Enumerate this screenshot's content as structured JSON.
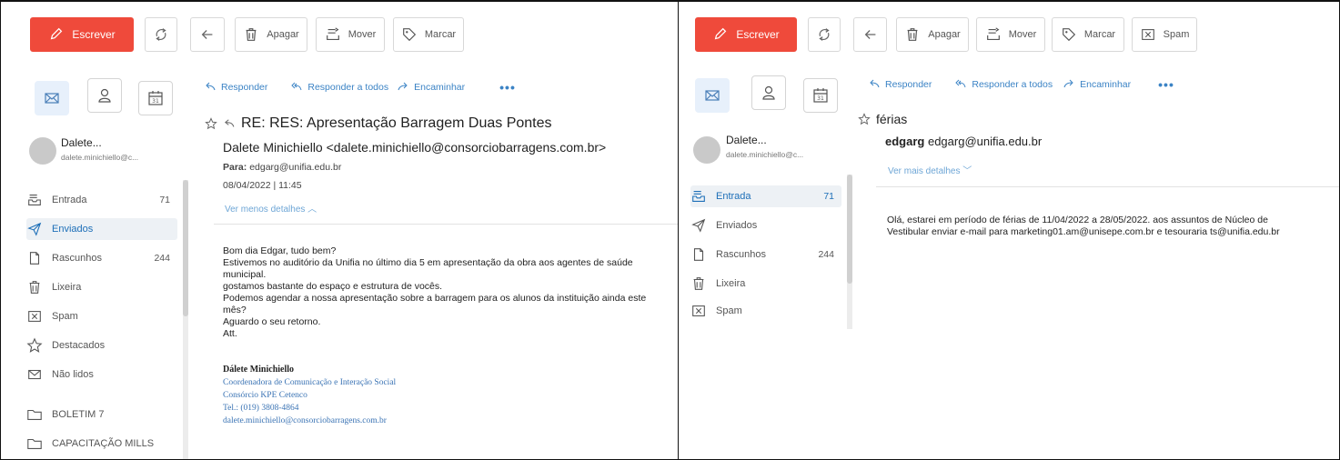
{
  "colors": {
    "accent": "#ef4a3b",
    "link": "#3b83c5",
    "selected_bg": "#edf1f5"
  },
  "left": {
    "toolbar": {
      "compose": "Escrever",
      "delete": "Apagar",
      "move": "Mover",
      "tag": "Marcar"
    },
    "account": {
      "name": "Dalete...",
      "email": "dalete.minichiello@c..."
    },
    "folders": [
      {
        "label": "Entrada",
        "count": "71",
        "icon": "inbox-icon"
      },
      {
        "label": "Enviados",
        "count": "",
        "icon": "sent-icon"
      },
      {
        "label": "Rascunhos",
        "count": "244",
        "icon": "drafts-icon"
      },
      {
        "label": "Lixeira",
        "count": "",
        "icon": "trash-icon"
      },
      {
        "label": "Spam",
        "count": "",
        "icon": "spam-icon"
      },
      {
        "label": "Destacados",
        "count": "",
        "icon": "star-icon"
      },
      {
        "label": "Não lidos",
        "count": "",
        "icon": "unread-icon"
      },
      {
        "label": "BOLETIM 7",
        "count": "",
        "icon": "folder-icon"
      },
      {
        "label": "CAPACITAÇÃO MILLS",
        "count": "",
        "icon": "folder-icon"
      }
    ],
    "actions": {
      "reply": "Responder",
      "reply_all": "Responder a todos",
      "forward": "Encaminhar",
      "more": "•••"
    },
    "message": {
      "subject": "RE: RES: Apresentação Barragem Duas Pontes",
      "from": "Dalete Minichiello <dalete.minichiello@consorciobarragens.com.br>",
      "to_label": "Para:",
      "to": "edgarg@unifia.edu.br",
      "date": "08/04/2022 | 11:45",
      "details_toggle": "Ver menos detalhes",
      "body": [
        "Bom dia Edgar, tudo bem?",
        "Estivemos no auditório da Unifia no último dia 5 em apresentação da obra aos agentes de saúde",
        "municipal.",
        "gostamos bastante do espaço e estrutura de vocês.",
        "Podemos agendar a nossa apresentação sobre a barragem para os alunos da instituição ainda este",
        "mês?",
        "Aguardo o seu retorno.",
        "Att."
      ],
      "signature": {
        "name": "Dálete Minichiello",
        "role": "Coordenadora de Comunicação e Interação Social",
        "company": "Consórcio KPE Cetenco",
        "phone": "Tel.: (019) 3808-4864",
        "email": "dalete.minichiello@consorciobarragens.com.br"
      }
    }
  },
  "right": {
    "toolbar": {
      "compose": "Escrever",
      "delete": "Apagar",
      "move": "Mover",
      "tag": "Marcar",
      "spam": "Spam"
    },
    "account": {
      "name": "Dalete...",
      "email": "dalete.minichiello@c..."
    },
    "folders": [
      {
        "label": "Entrada",
        "count": "71",
        "icon": "inbox-icon"
      },
      {
        "label": "Enviados",
        "count": "",
        "icon": "sent-icon"
      },
      {
        "label": "Rascunhos",
        "count": "244",
        "icon": "drafts-icon"
      },
      {
        "label": "Lixeira",
        "count": "",
        "icon": "trash-icon"
      },
      {
        "label": "Spam",
        "count": "",
        "icon": "spam-icon"
      }
    ],
    "actions": {
      "reply": "Responder",
      "reply_all": "Responder a todos",
      "forward": "Encaminhar",
      "more": "•••"
    },
    "message": {
      "subject": "férias",
      "from_name": "edgarg",
      "from_email": "edgarg@unifia.edu.br",
      "details_toggle": "Ver mais detalhes",
      "body": [
        "Olá, estarei em período de férias de 11/04/2022  a 28/05/2022. aos assuntos de Núcleo de",
        "Vestibular enviar e-mail para marketing01.am@unisepe.com.br e tesouraria ts@unifia.edu.br"
      ]
    }
  }
}
